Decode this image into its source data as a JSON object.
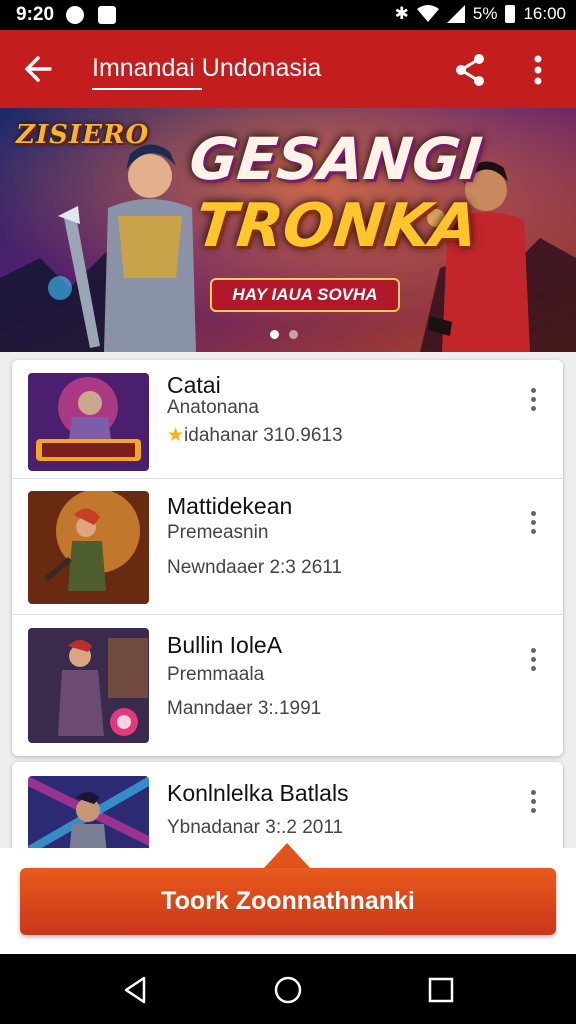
{
  "status_bar": {
    "time": "9:20",
    "battery": "5%",
    "clock_right": "16:00"
  },
  "app_bar": {
    "title": "Imnandai Undonasia",
    "back_icon": "arrow-left-icon",
    "share_icon": "share-icon",
    "more_icon": "more-vertical-icon"
  },
  "banner": {
    "logo_text": "ZISIERO",
    "title_line1": "GESANGI",
    "title_line2": "TRONKA",
    "badge": "HAY IAUA SOVHA",
    "page_indicator": {
      "count": 2,
      "active": 0
    }
  },
  "games": [
    {
      "title": "Catai",
      "subtitle": "Anatonana",
      "meta": "idahanar 310.9613",
      "rated": true
    },
    {
      "title": "Mattidekean",
      "subtitle": "Premeasnin",
      "meta": "Newndaaer 2:3 2611",
      "rated": false
    },
    {
      "title": "Bullin IoleA",
      "subtitle": "Premmaala",
      "meta": "Manndaer 3:.1991",
      "rated": false
    },
    {
      "title": "Konlnlelka Batlals",
      "subtitle": "",
      "meta": "Ybnadanar 3:.2 2011",
      "rated": false
    }
  ],
  "cta": {
    "label": "Toork Zoonnathnanki"
  },
  "nav_bar": {
    "back": "triangle-back-icon",
    "home": "circle-home-icon",
    "recents": "square-recents-icon"
  },
  "colors": {
    "primary": "#c41d1d",
    "cta": "#d9461b",
    "star": "#f3b51a"
  }
}
